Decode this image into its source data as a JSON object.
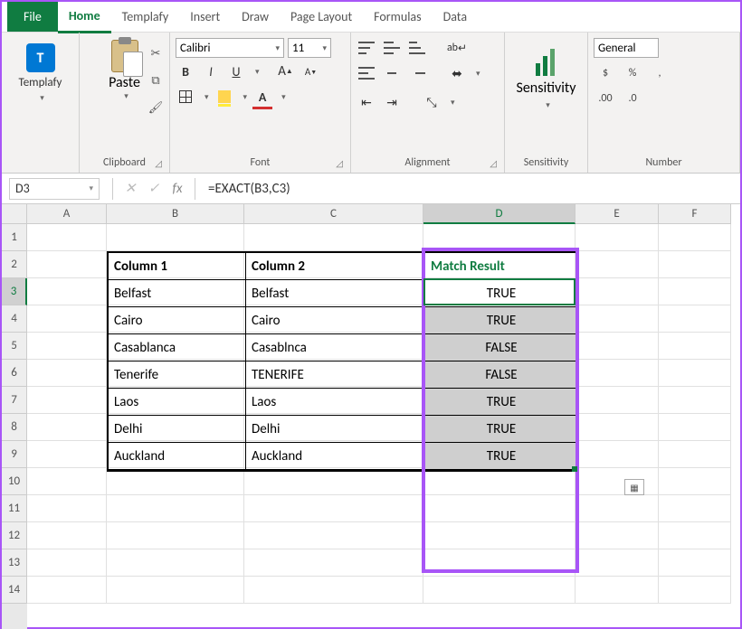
{
  "tabs": {
    "file": "File",
    "home": "Home",
    "templafy": "Templafy",
    "insert": "Insert",
    "draw": "Draw",
    "page_layout": "Page Layout",
    "formulas": "Formulas",
    "data": "Data"
  },
  "ribbon": {
    "templafy": {
      "label": "Templafy",
      "icon_letter": "T"
    },
    "clipboard": {
      "paste": "Paste",
      "group": "Clipboard"
    },
    "font": {
      "name": "Calibri",
      "size": "11",
      "bold": "B",
      "italic": "I",
      "underline": "U",
      "group": "Font"
    },
    "alignment": {
      "group": "Alignment",
      "wrap": "ab"
    },
    "sensitivity": {
      "label": "Sensitivity",
      "group": "Sensitivity"
    },
    "number": {
      "format": "General",
      "group": "Number",
      "inc": ".00",
      "dec": ".0"
    }
  },
  "formula_bar": {
    "cell_ref": "D3",
    "formula": "=EXACT(B3,C3)",
    "fx": "fx"
  },
  "columns": [
    "A",
    "B",
    "C",
    "D",
    "E",
    "F"
  ],
  "rows": [
    "1",
    "2",
    "3",
    "4",
    "5",
    "6",
    "7",
    "8",
    "9",
    "10",
    "11",
    "12",
    "13",
    "14"
  ],
  "table": {
    "headers": {
      "c1": "Column 1",
      "c2": "Column 2",
      "c3": "Match Result"
    },
    "data": [
      {
        "c1": "Belfast",
        "c2": "Belfast",
        "c3": "TRUE"
      },
      {
        "c1": "Cairo",
        "c2": "Cairo",
        "c3": "TRUE"
      },
      {
        "c1": "Casablanca",
        "c2": "Casablnca",
        "c3": "FALSE"
      },
      {
        "c1": "Tenerife",
        "c2": "TENERIFE",
        "c3": "FALSE"
      },
      {
        "c1": "Laos",
        "c2": "Laos",
        "c3": "TRUE"
      },
      {
        "c1": "Delhi",
        "c2": "Delhi",
        "c3": "TRUE"
      },
      {
        "c1": "Auckland",
        "c2": "Auckland",
        "c3": "TRUE"
      }
    ]
  }
}
